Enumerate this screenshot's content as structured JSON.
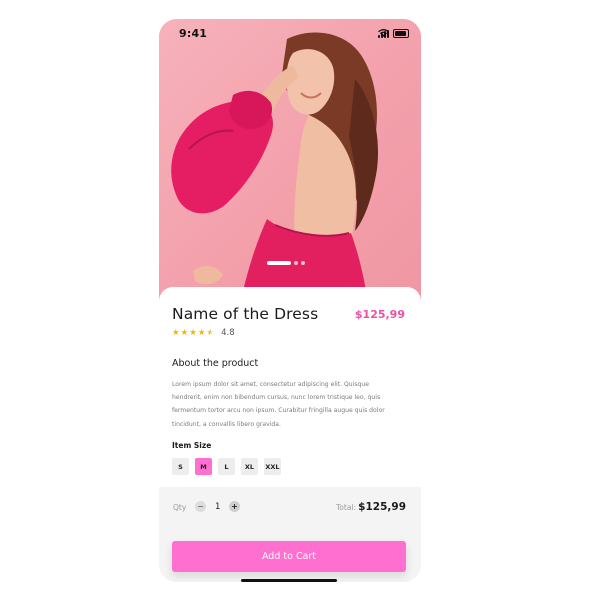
{
  "status_bar": {
    "time": "9:41"
  },
  "hero": {
    "image": "model-in-pink-dress-photo",
    "carousel": {
      "total": 3,
      "active_index": 0
    }
  },
  "product": {
    "name": "Name of the Dress",
    "price": "$125,99",
    "rating_value": "4.8",
    "rating_stars": 4.5,
    "about_heading": "About the product",
    "description": "Lorem ipsum dolor sit amet, consectetur adipiscing elit. Quisque hendrerit, enim non bibendum cursus, nunc lorem tristique leo, quis fermentum tortor arcu non ipsum. Curabitur fringilla augue quis dolor tincidunt, a convallis libero gravida.",
    "size_heading": "Item Size",
    "sizes": [
      "S",
      "M",
      "L",
      "XL",
      "XXL"
    ],
    "selected_size": "M"
  },
  "cart": {
    "qty_label": "Qty",
    "minus_symbol": "−",
    "quantity": "1",
    "plus_symbol": "+",
    "total_label": "Total:",
    "total_value": "$125,99",
    "add_button_label": "Add to Cart"
  },
  "colors": {
    "accent": "#ff6fcf",
    "price": "#ef4fa3",
    "star": "#f5b400",
    "hero_background": "#f5a3ad"
  },
  "icons": [
    "signal-icon",
    "wifi-icon",
    "battery-icon",
    "star-icon"
  ]
}
